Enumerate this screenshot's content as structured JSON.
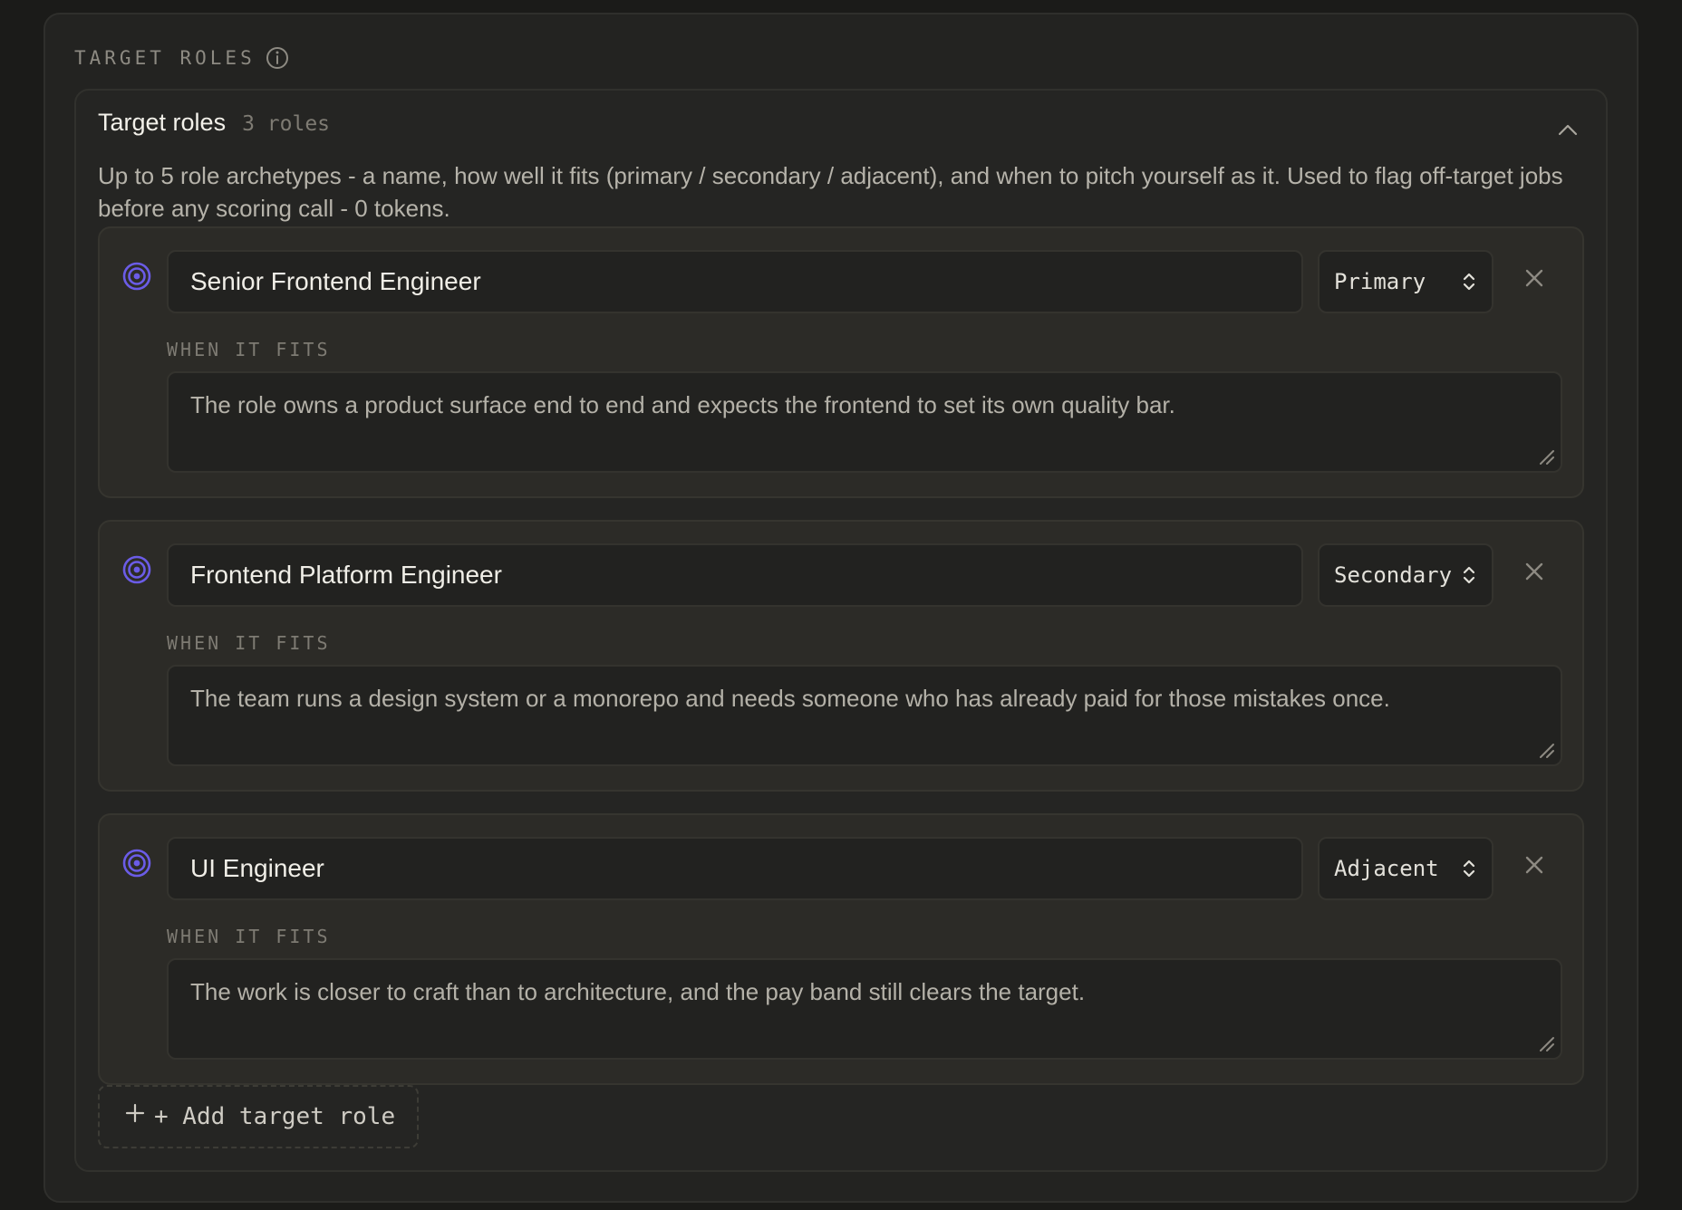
{
  "section": {
    "heading": "TARGET ROLES",
    "info_icon": "info-icon"
  },
  "card": {
    "title": "Target roles",
    "count": "3 roles",
    "collapse_icon": "chevron-up-icon",
    "description": "Up to 5 role archetypes - a name, how well it fits (primary / secondary / adjacent), and when to pitch yourself as it. Used to flag off-target jobs before any scoring call - 0 tokens."
  },
  "roles": [
    {
      "name": "Senior Frontend Engineer",
      "fit": "Primary",
      "when_label": "WHEN IT FITS",
      "when": "The role owns a product surface end to end and expects the frontend to set its own quality bar."
    },
    {
      "name": "Frontend Platform Engineer",
      "fit": "Secondary",
      "when_label": "WHEN IT FITS",
      "when": "The team runs a design system or a monorepo and needs someone who has already paid for those mistakes once."
    },
    {
      "name": "UI Engineer",
      "fit": "Adjacent",
      "when_label": "WHEN IT FITS",
      "when": "The work is closer to craft than to architecture, and the pay band still clears the target."
    }
  ],
  "add_button": {
    "label": "+ Add target role",
    "icon": "plus-icon"
  },
  "colors": {
    "accent": "#6b5ce7",
    "background": "#1b1b19",
    "panel": "#232321",
    "role_card": "#2c2b27"
  }
}
